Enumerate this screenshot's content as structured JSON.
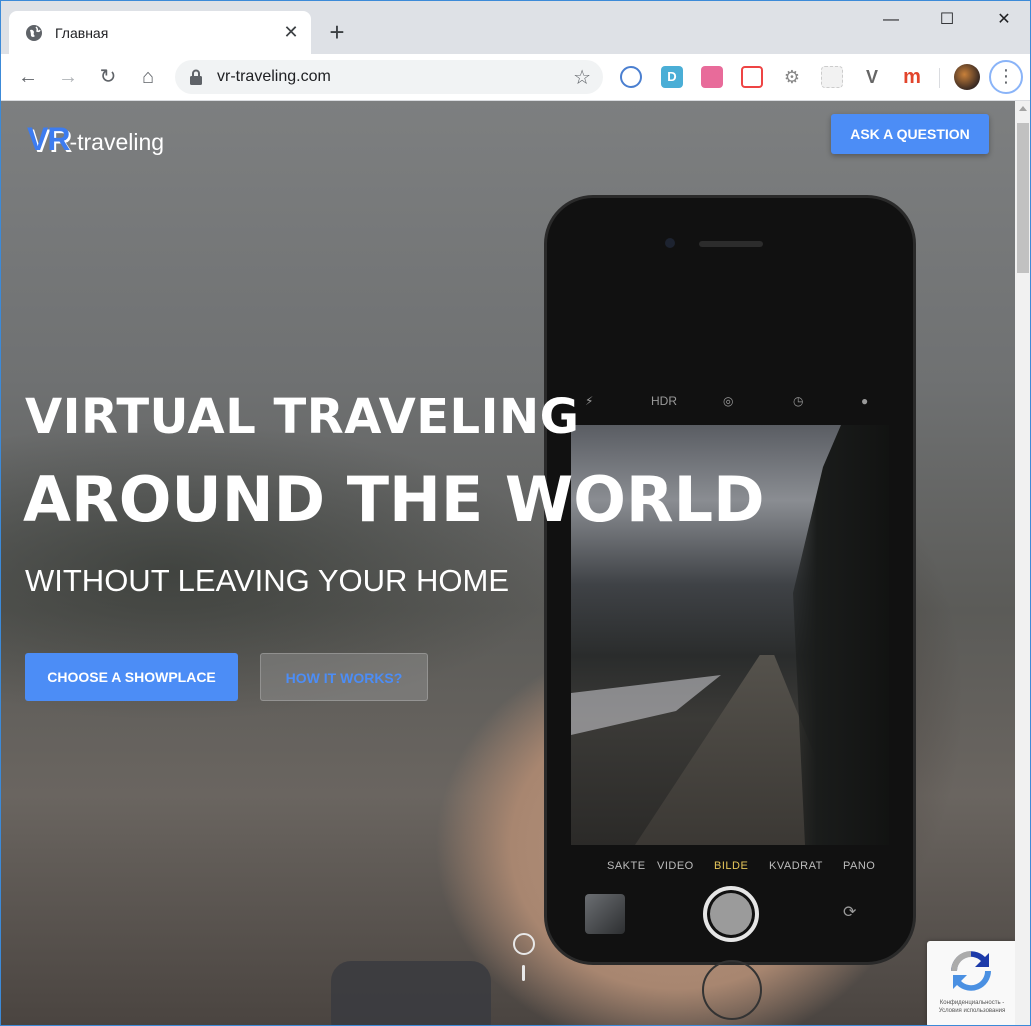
{
  "browser": {
    "tab_title": "Главная",
    "tab_close": "✕",
    "new_tab": "+",
    "window_controls": {
      "minimize": "—",
      "maximize": "☐",
      "close": "✕"
    },
    "nav": {
      "back": "←",
      "forward": "→",
      "reload": "↻",
      "home": "⌂"
    },
    "url": "vr-traveling.com",
    "bookmark_star": "☆",
    "extensions": [
      {
        "name": "circle-ext-icon",
        "label": "",
        "color": "#4a7fd0"
      },
      {
        "name": "d-ext-icon",
        "label": "D",
        "color": "#4aaed6"
      },
      {
        "name": "pink-ext-icon",
        "label": "",
        "color": "#e86b9a"
      },
      {
        "name": "calendar-ext-icon",
        "label": "",
        "color": "#e44"
      },
      {
        "name": "gear-ext-icon",
        "label": "⚙",
        "color": "#888"
      },
      {
        "name": "grid-ext-icon",
        "label": "",
        "color": "#ddd"
      },
      {
        "name": "v-ext-icon",
        "label": "V",
        "color": "#666"
      },
      {
        "name": "m-ext-icon",
        "label": "m",
        "color": "#e2452c"
      }
    ],
    "menu": "⋮"
  },
  "site": {
    "logo_vr": "VR",
    "logo_rest": "-traveling",
    "ask_button": "ASK A QUESTION",
    "headline_1": "VIRTUAL TRAVELING",
    "headline_2": "AROUND THE WORLD",
    "headline_3": "WITHOUT LEAVING YOUR HOME",
    "primary_button": "CHOOSE A SHOWPLACE",
    "secondary_button": "HOW IT WORKS?",
    "accent_color": "#4c8df6"
  },
  "phone_camera": {
    "top_icons": [
      "⚡",
      "HDR",
      "◎",
      "◷",
      "●"
    ],
    "modes": [
      "SAKTE",
      "VIDEO",
      "BILDE",
      "KVADRAT",
      "PANO"
    ]
  },
  "recaptcha": {
    "legal_line_1": "Конфиденциальность -",
    "legal_line_2": "Условия использования"
  }
}
